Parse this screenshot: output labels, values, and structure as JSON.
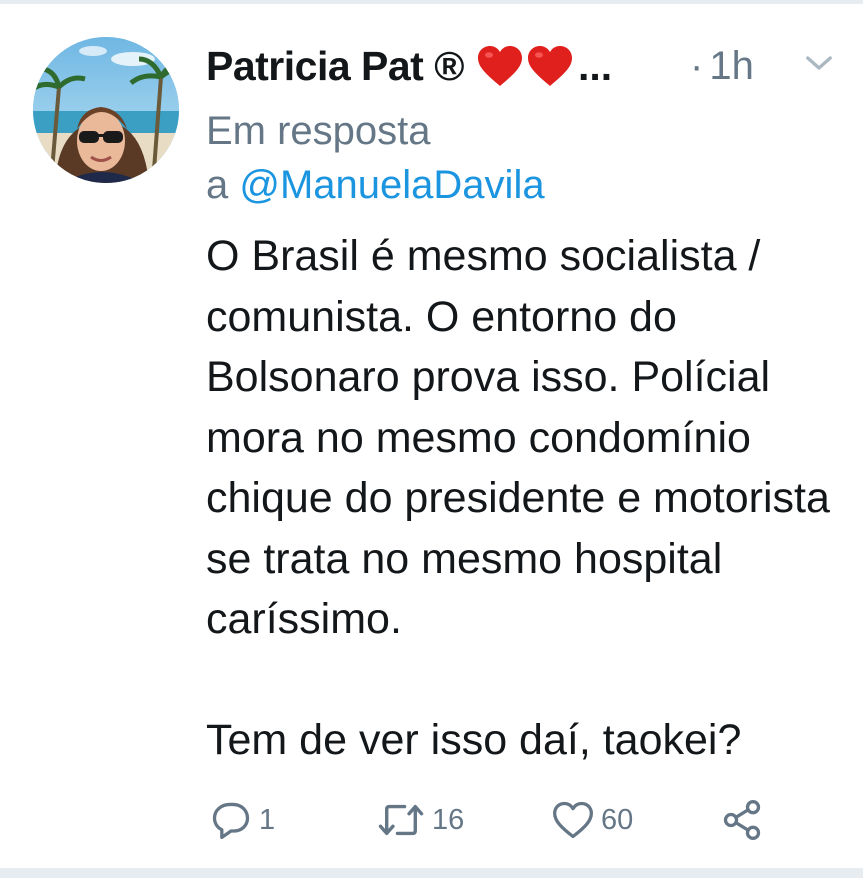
{
  "tweet": {
    "display_name": "Patricia Pat ®",
    "ellipsis": "...",
    "separator": "·",
    "time": "1h",
    "reply_prefix": "Em resposta",
    "reply_a": "a",
    "reply_mention": "@ManuelaDavila",
    "text": "O Brasil é mesmo socialista / comunista. O entorno do Bolsonaro prova isso. Polícial mora no mesmo condomínio chique do presidente e motorista se trata no mesmo hospital caríssimo.\n\nTem de ver isso daí, taokei?"
  },
  "actions": {
    "reply_count": "1",
    "retweet_count": "16",
    "like_count": "60"
  },
  "icons": {
    "heart_emoji": "red-heart-icon",
    "chevron": "chevron-down-icon",
    "reply": "reply-icon",
    "retweet": "retweet-icon",
    "like": "heart-icon",
    "share": "share-icon"
  },
  "colors": {
    "text": "#14171a",
    "secondary": "#657786",
    "link": "#1b95e0",
    "heart_emoji": "#e0201c"
  }
}
